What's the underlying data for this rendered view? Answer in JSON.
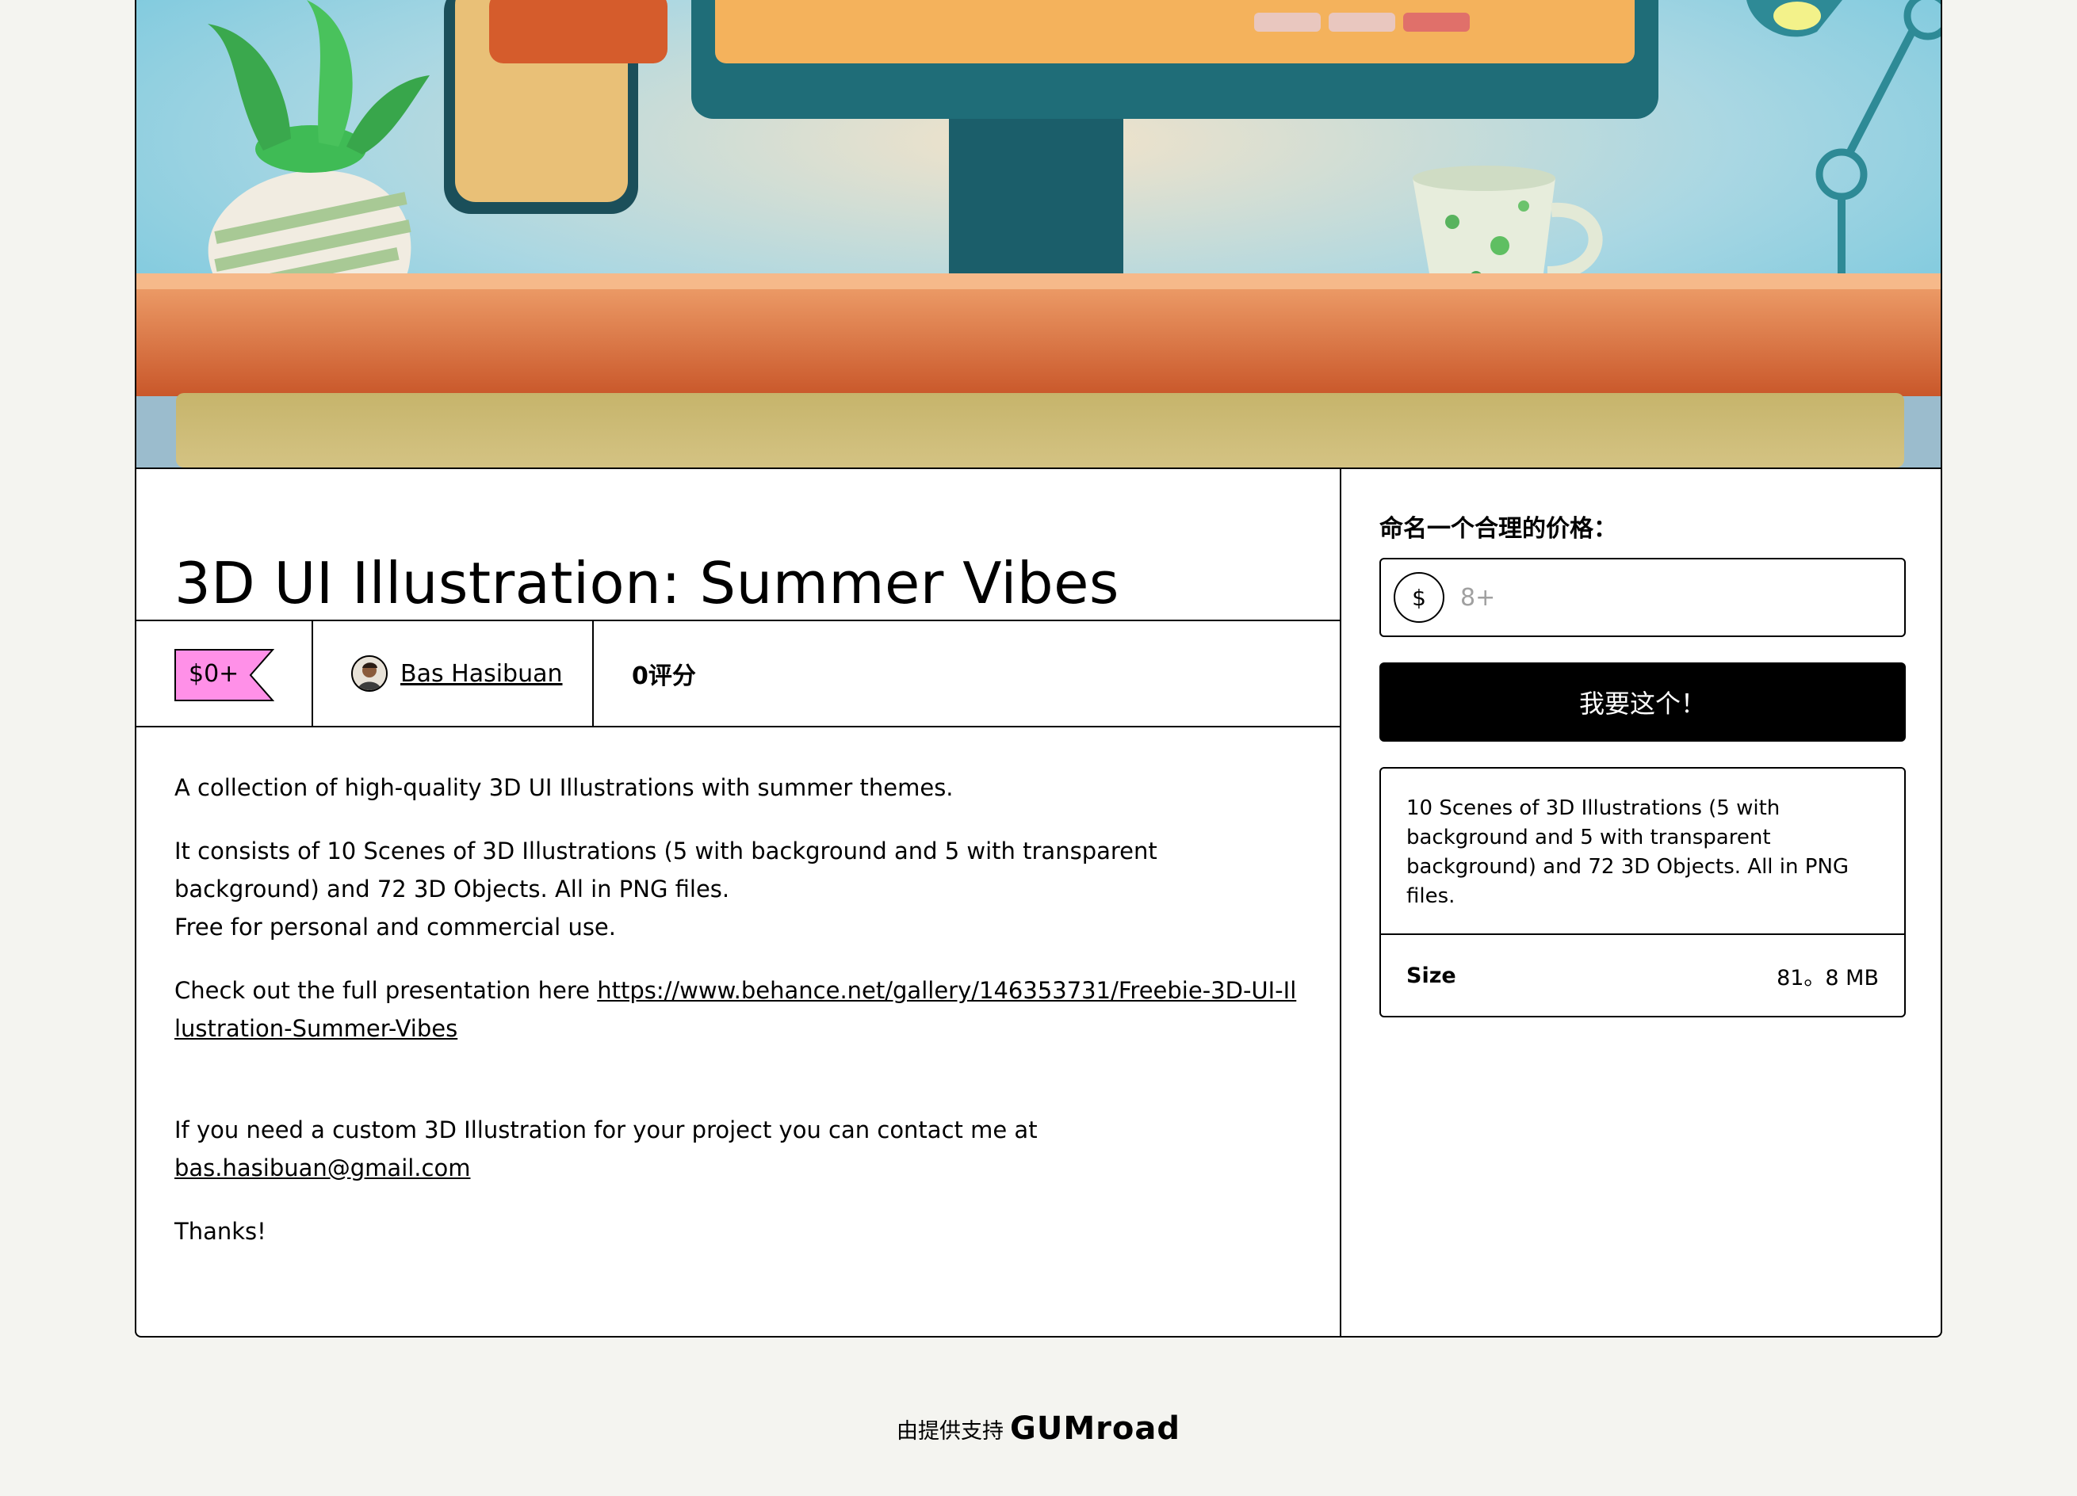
{
  "product": {
    "title": "3D UI Illustration: Summer Vibes",
    "price_tag": "$0+",
    "author_name": "Bas Hasibuan",
    "ratings": "0评分"
  },
  "description": {
    "p1": "A collection of high-quality 3D UI Illustrations with summer themes.",
    "p2_line1": "It consists of 10 Scenes of 3D Illustrations (5 with background and 5 with transparent background) and 72 3D Objects. All in PNG files.",
    "p2_line2": "Free for personal and commercial use.",
    "p3_text": "Check out the full presentation here ",
    "p3_link": "https://www.behance.net/gallery/146353731/Freebie-3D-UI-Illustration-Summer-Vibes",
    "p4_text": "If you need a custom 3D Illustration for your project you can contact me at ",
    "p4_email": "bas.hasibuan@gmail.com",
    "p5": "Thanks!"
  },
  "purchase": {
    "price_label": "命名一个合理的价格：",
    "currency_symbol": "$",
    "price_placeholder": "8+",
    "buy_label": "我要这个！",
    "summary": "10 Scenes of 3D Illustrations (5 with background and 5 with transparent background) and 72 3D Objects. All in PNG files.",
    "size_label": "Size",
    "size_value": "81。8 MB"
  },
  "footer": {
    "powered_by": "由提供支持",
    "brand": "GUMroad"
  },
  "colors": {
    "price_tag_bg": "#ff90e8",
    "accent_black": "#000000",
    "page_bg": "#f4f4f0"
  }
}
